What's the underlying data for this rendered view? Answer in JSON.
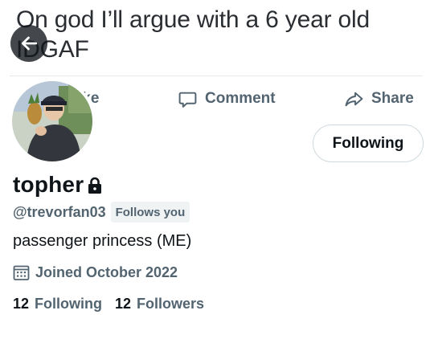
{
  "banner": {
    "line1": "On god I’ll argue with a 6 year old",
    "line2": "IDGAF"
  },
  "post_actions": {
    "like_label": "Like",
    "like_visible": "ike",
    "comment_label": "Comment",
    "share_label": "Share"
  },
  "profile": {
    "display_name": "topher",
    "handle": "@trevorfan03",
    "follows_you": "Follows you",
    "bio": "passenger princess (ME)",
    "joined": "Joined October 2022",
    "following_count": "12",
    "following_label": "Following",
    "followers_count": "12",
    "followers_label": "Followers",
    "follow_button": "Following",
    "protected": true
  },
  "icons": {
    "back": "arrow-left-icon",
    "comment": "comment-icon",
    "share": "share-icon",
    "lock": "lock-icon",
    "calendar": "calendar-icon"
  },
  "colors": {
    "text_primary": "#0f1419",
    "text_secondary": "#536471",
    "badge_bg": "#eff3f4",
    "button_border": "#cfd9de"
  }
}
